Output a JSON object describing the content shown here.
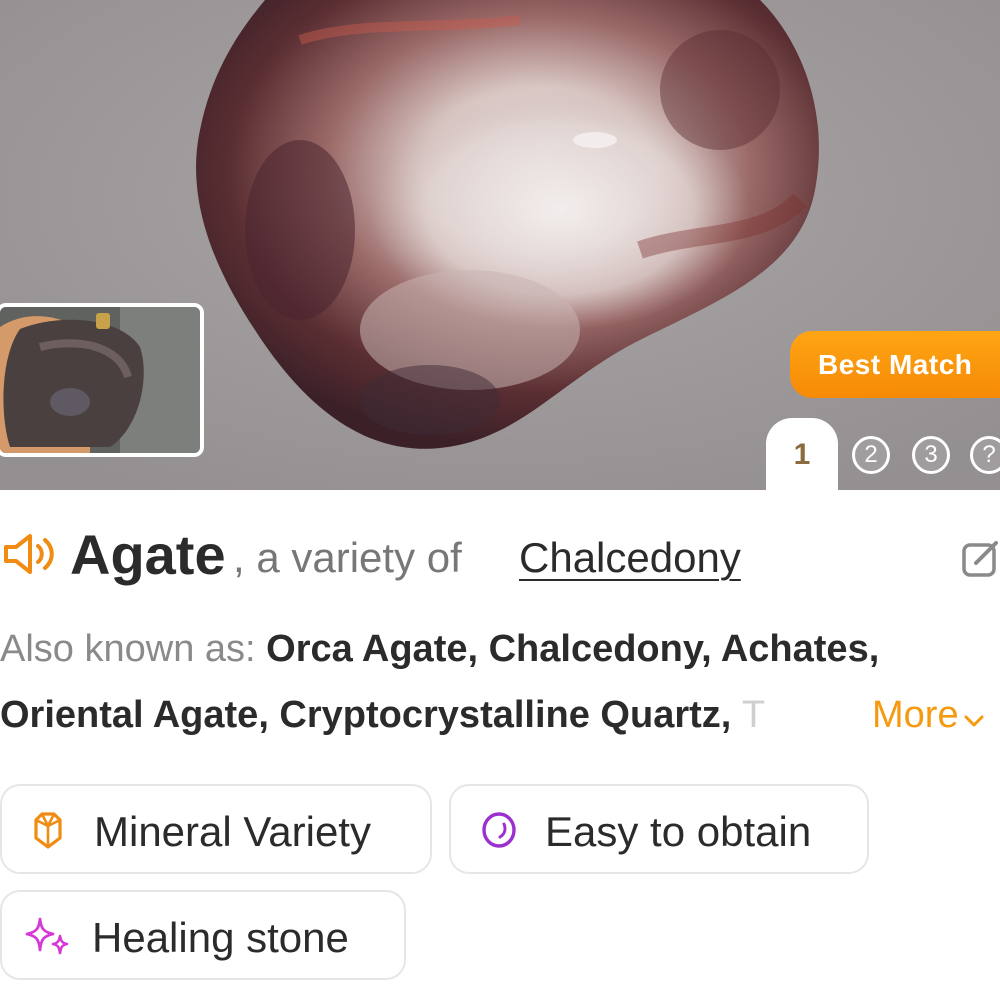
{
  "hero": {
    "badge_label": "Best Match",
    "pages": [
      "1",
      "2",
      "3",
      "?"
    ],
    "active_page": "1"
  },
  "title": {
    "name": "Agate",
    "separator_text": ", a variety of",
    "parent_link": "Chalcedony"
  },
  "aliases": {
    "label": "Also known as:",
    "line1": "Orca Agate, Chalcedony, Achates,",
    "line2": "Oriental Agate, Cryptocrystalline Quartz,",
    "line2_faded": "T",
    "more_label": "More"
  },
  "tags": [
    {
      "label": "Mineral Variety",
      "icon": "crystal-icon",
      "color": "#f08c12"
    },
    {
      "label": "Easy to obtain",
      "icon": "stone-icon",
      "color": "#9b2fd0"
    },
    {
      "label": "Healing stone",
      "icon": "sparkle-icon",
      "color": "#d63ad6"
    }
  ],
  "colors": {
    "accent": "#f59a10",
    "text": "#2b2b2b",
    "muted": "#8a8a8a"
  }
}
